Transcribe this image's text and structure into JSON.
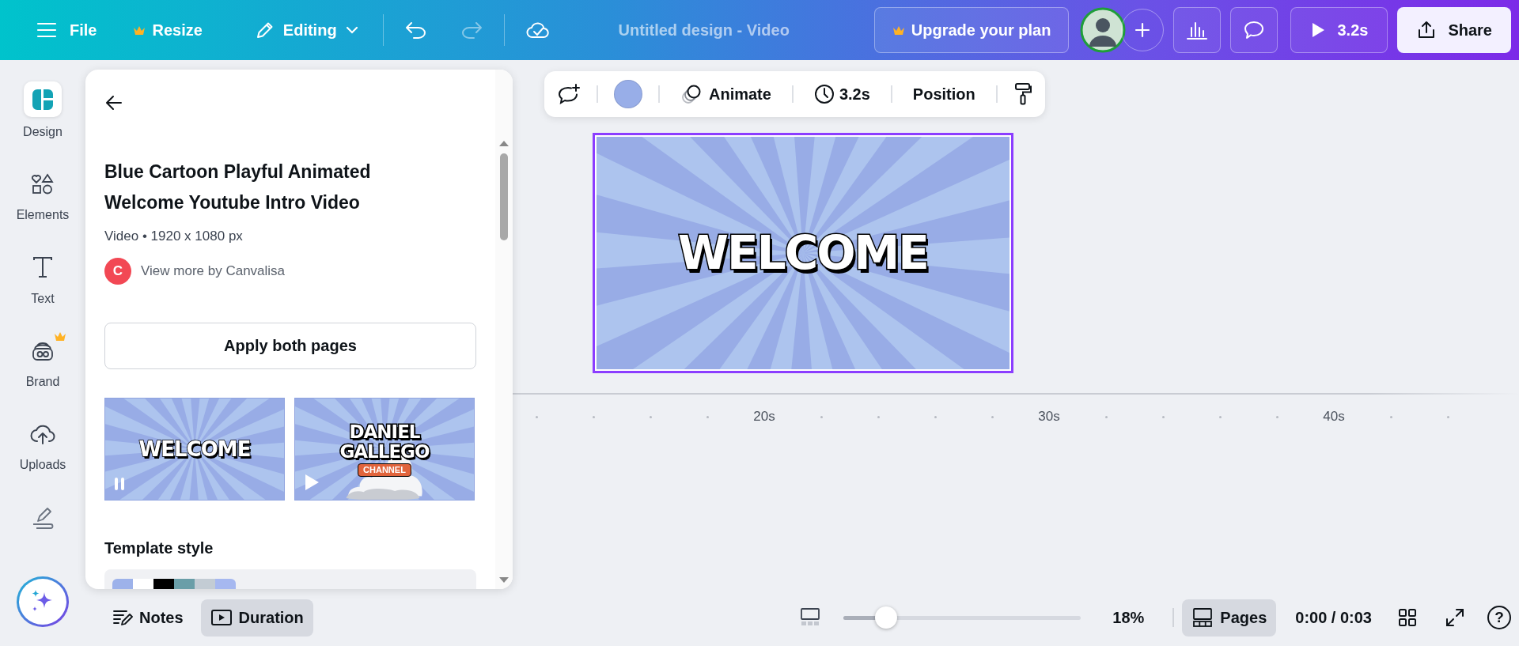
{
  "top_bar": {
    "file": "File",
    "resize": "Resize",
    "mode": "Editing",
    "undo": {
      "disabled": false
    },
    "redo": {
      "disabled": true
    },
    "title": "Untitled design - Video",
    "upgrade": "Upgrade your plan",
    "play_duration": "3.2s",
    "share": "Share"
  },
  "rail": {
    "items": [
      {
        "kind": "design",
        "label": "Design",
        "selected": true,
        "premium": false
      },
      {
        "kind": "elements",
        "label": "Elements",
        "selected": false,
        "premium": false
      },
      {
        "kind": "text",
        "label": "Text",
        "selected": false,
        "premium": false
      },
      {
        "kind": "brand",
        "label": "Brand",
        "selected": false,
        "premium": true
      },
      {
        "kind": "uploads",
        "label": "Uploads",
        "selected": false,
        "premium": false
      },
      {
        "kind": "draw",
        "selected": false,
        "premium": false
      }
    ]
  },
  "panel": {
    "title": "Blue Cartoon Playful Animated Welcome Youtube Intro Video",
    "meta": "Video • 1920 x 1080 px",
    "author": {
      "initial": "C",
      "link": "View more by Canvalisa"
    },
    "apply": "Apply both pages",
    "pages": [
      {
        "kind": "welcome",
        "texts": [
          "WELCOME"
        ],
        "playing": true
      },
      {
        "kind": "channel",
        "texts": [
          "DANIEL",
          "GALLEGO"
        ],
        "tag": "CHANNEL",
        "playing": false
      }
    ],
    "style_title": "Template style",
    "swatches": [
      {
        "color": "#9db2ea"
      },
      {
        "color": "#ffffff"
      },
      {
        "color": "#000000"
      },
      {
        "color": "#6a9ea8"
      },
      {
        "color": "#c3ccd4"
      },
      {
        "color": "#a6b8f0"
      }
    ]
  },
  "toolbar": {
    "color": "#98aee8",
    "animate": "Animate",
    "duration": "3.2s",
    "position": "Position"
  },
  "canvas": {
    "heading": "WELCOME",
    "selected": true
  },
  "timeline": {
    "labels": [
      "20s",
      "30s",
      "40s"
    ]
  },
  "bottom_bar": {
    "notes": "Notes",
    "duration": {
      "label": "Duration",
      "selected": true
    },
    "zoom": {
      "level": 0.18,
      "reading": "18%"
    },
    "pages": {
      "label": "Pages",
      "selected": true
    },
    "time": "0:00 / 0:03",
    "help": "?"
  }
}
